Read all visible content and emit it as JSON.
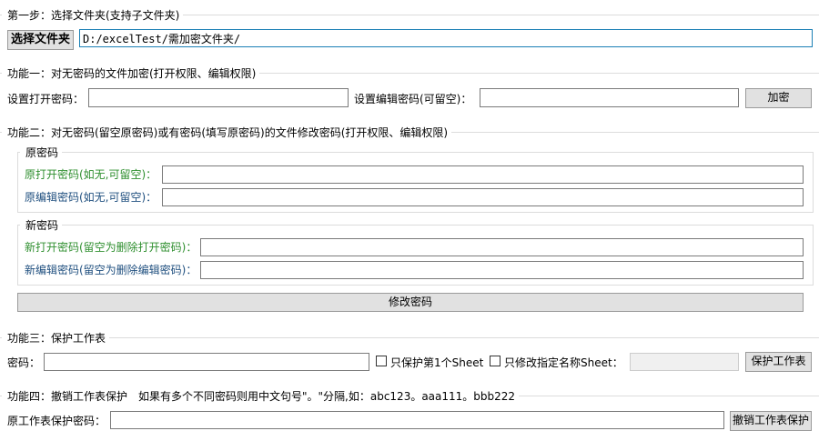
{
  "step1": {
    "legend": "第一步：选择文件夹(支持子文件夹)",
    "choose_button": "选择文件夹",
    "folder_path": "D:/excelTest/需加密文件夹/"
  },
  "func1": {
    "legend": "功能一：对无密码的文件加密(打开权限、编辑权限)",
    "open_label": "设置打开密码：",
    "edit_label": "设置编辑密码(可留空)：",
    "encrypt_button": "加密"
  },
  "func2": {
    "legend": "功能二：对无密码(留空原密码)或有密码(填写原密码)的文件修改密码(打开权限、编辑权限)",
    "old_group": "原密码",
    "old_open_label": "原打开密码(如无,可留空)：",
    "old_edit_label": "原编辑密码(如无,可留空)：",
    "new_group": "新密码",
    "new_open_label": "新打开密码(留空为删除打开密码)：",
    "new_edit_label": "新编辑密码(留空为删除编辑密码)：",
    "modify_button": "修改密码"
  },
  "func3": {
    "legend": "功能三：保护工作表",
    "password_label": "密码：",
    "only_first_label": "只保护第1个Sheet",
    "only_named_label": "只修改指定名称Sheet：",
    "protect_button": "保护工作表"
  },
  "func4": {
    "legend": "功能四：撤销工作表保护　如果有多个不同密码则用中文句号\"。\"分隔,如：abc123。aaa111。bbb222",
    "old_password_label": "原工作表保护密码：",
    "unprotect_button": "撤销工作表保护"
  }
}
